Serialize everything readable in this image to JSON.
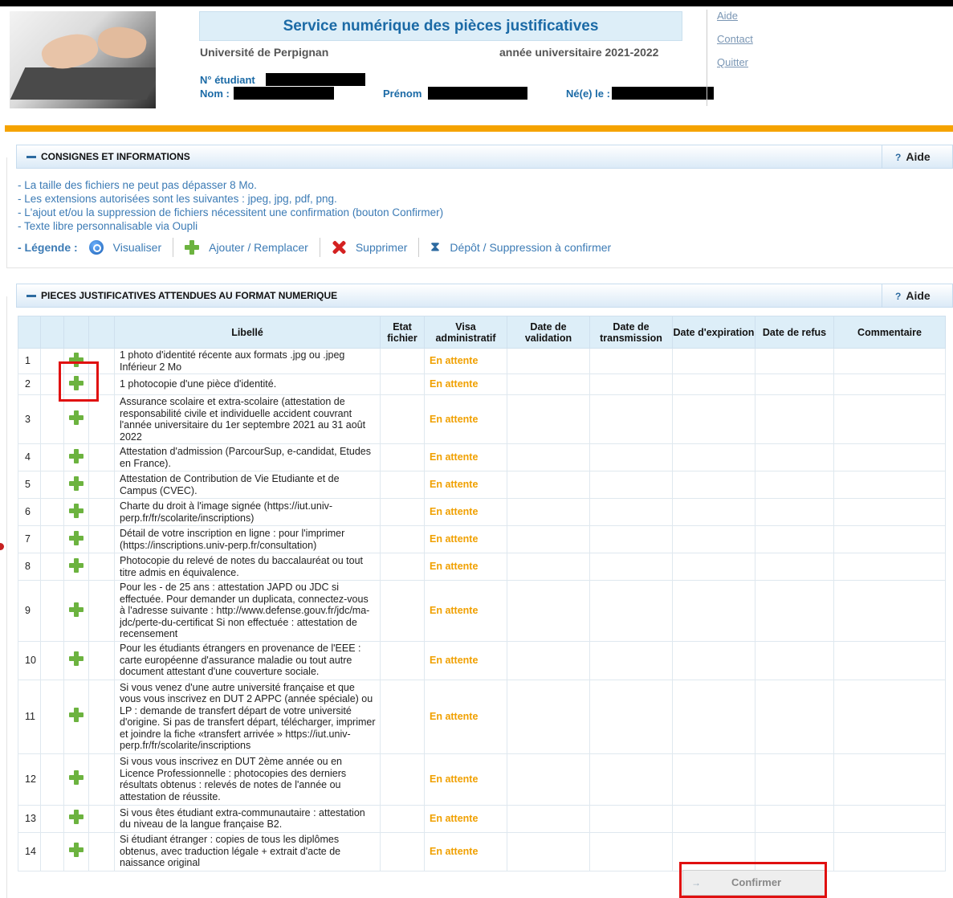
{
  "header": {
    "service_title": "Service numérique des pièces justificatives",
    "university": "Université de Perpignan",
    "year": "année universitaire 2021-2022",
    "student_number_label": "N° étudiant",
    "name_label": "Nom :",
    "firstname_label": "Prénom",
    "birth_label": "Né(e) le :"
  },
  "toplinks": {
    "aide": "Aide",
    "contact": "Contact",
    "quitter": "Quitter"
  },
  "consignes": {
    "title": "CONSIGNES ET INFORMATIONS",
    "aide": "Aide",
    "lines": [
      "- La taille des fichiers ne peut pas dépasser 8 Mo.",
      "- Les extensions autorisées sont les suivantes : jpeg, jpg, pdf, png.",
      "- L'ajout et/ou la suppression de fichiers nécessitent une confirmation (bouton Confirmer)",
      "- Texte libre personnalisable via Oupli"
    ],
    "legend_label": "- Légende :",
    "legend": {
      "view": "Visualiser",
      "add": "Ajouter / Remplacer",
      "delete": "Supprimer",
      "pending": "Dépôt / Suppression à confirmer"
    }
  },
  "pieces": {
    "title": "PIECES JUSTIFICATIVES ATTENDUES AU FORMAT NUMERIQUE",
    "aide": "Aide",
    "columns": {
      "libelle": "Libellé",
      "etat": "Etat fichier",
      "visa": "Visa administratif",
      "validation": "Date de validation",
      "transmission": "Date de transmission",
      "expiration": "Date d'expiration",
      "refus": "Date de refus",
      "commentaire": "Commentaire"
    },
    "rows": [
      {
        "num": "1",
        "libelle": "1 photo d'identité récente aux formats .jpg ou .jpeg Inférieur 2 Mo",
        "visa": "En attente"
      },
      {
        "num": "2",
        "libelle": "1 photocopie d'une pièce d'identité.",
        "visa": "En attente"
      },
      {
        "num": "3",
        "libelle": "Assurance scolaire et extra-scolaire (attestation de responsabilité civile et individuelle accident couvrant l'année universitaire du 1er septembre 2021 au 31 août 2022",
        "visa": "En attente"
      },
      {
        "num": "4",
        "libelle": "Attestation d'admission (ParcourSup, e-candidat, Etudes en France).",
        "visa": "En attente"
      },
      {
        "num": "5",
        "libelle": "Attestation de Contribution de Vie Etudiante et de Campus (CVEC).",
        "visa": "En attente"
      },
      {
        "num": "6",
        "libelle": "Charte du droit à l'image signée (https://iut.univ-perp.fr/fr/scolarite/inscriptions)",
        "visa": "En attente"
      },
      {
        "num": "7",
        "libelle": "Détail de votre inscription en ligne : pour l'imprimer (https://inscriptions.univ-perp.fr/consultation)",
        "visa": "En attente"
      },
      {
        "num": "8",
        "libelle": "Photocopie du relevé de notes du baccalauréat ou tout titre admis en équivalence.",
        "visa": "En attente"
      },
      {
        "num": "9",
        "libelle": "Pour les - de 25 ans : attestation JAPD ou JDC si effectuée. Pour demander un duplicata, connectez-vous à l'adresse suivante : http://www.defense.gouv.fr/jdc/ma-jdc/perte-du-certificat Si non effectuée : attestation de recensement",
        "visa": "En attente"
      },
      {
        "num": "10",
        "libelle": "Pour les étudiants étrangers en provenance de l'EEE : carte européenne d'assurance maladie ou tout autre document attestant d'une couverture sociale.",
        "visa": "En attente"
      },
      {
        "num": "11",
        "libelle": "Si vous venez d'une autre université française et que vous vous inscrivez en DUT 2 APPC (année spéciale) ou LP : demande de transfert départ de votre université d'origine. Si pas de transfert départ, télécharger, imprimer et joindre la fiche «transfert arrivée » https://iut.univ-perp.fr/fr/scolarite/inscriptions",
        "visa": "En attente"
      },
      {
        "num": "12",
        "libelle": "Si vous vous inscrivez en DUT 2ème année ou en Licence Professionnelle : photocopies des derniers résultats obtenus : relevés de notes de l'année ou attestation de réussite.",
        "visa": "En attente"
      },
      {
        "num": "13",
        "libelle": "Si vous êtes étudiant extra-communautaire : attestation du niveau de la langue française B2.",
        "visa": "En attente"
      },
      {
        "num": "14",
        "libelle": "Si étudiant étranger : copies de tous les diplômes obtenus, avec traduction légale + extrait d'acte de naissance original",
        "visa": "En attente"
      }
    ]
  },
  "confirm_label": "Confirmer",
  "colors": {
    "accent": "#1b6aa6",
    "orange_bar": "#f5a300",
    "pending": "#f0a000",
    "add_green": "#6cb33f",
    "highlight_red": "#e01010"
  }
}
